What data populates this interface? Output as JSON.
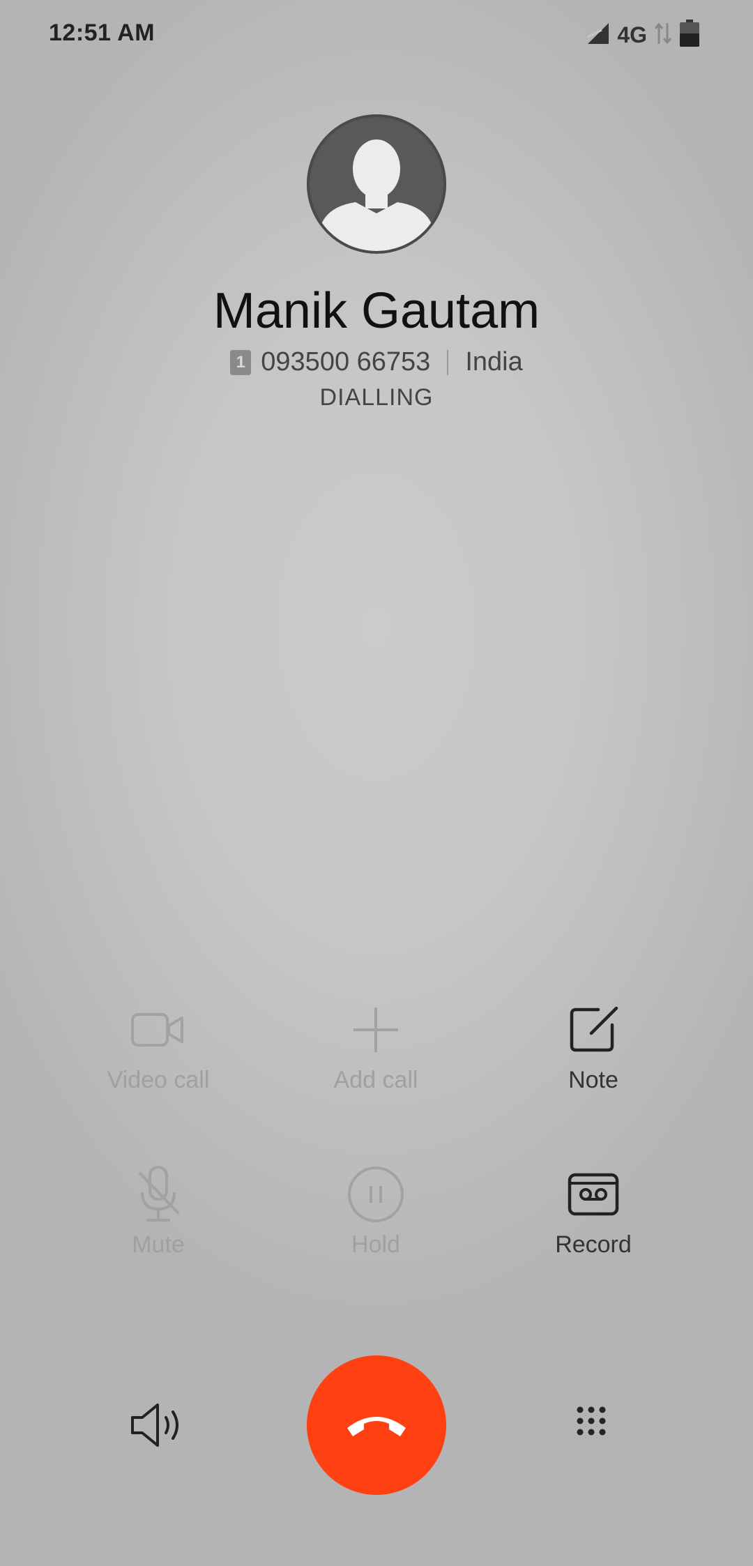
{
  "status_bar": {
    "time": "12:51 AM",
    "network": "4G",
    "icons": [
      "signal-icon",
      "data-arrows-icon",
      "battery-icon"
    ]
  },
  "contact": {
    "name": "Manik Gautam",
    "sim_slot": "1",
    "number": "093500 66753",
    "location": "India",
    "state": "DIALLING"
  },
  "actions": {
    "video_call": "Video call",
    "add_call": "Add call",
    "note": "Note",
    "mute": "Mute",
    "hold": "Hold",
    "record": "Record"
  },
  "colors": {
    "end_call": "#ff4012",
    "disabled_text": "#a0a0a0",
    "enabled_text": "#333333"
  },
  "bottom_icons": [
    "speaker-icon",
    "end-call-icon",
    "dialpad-icon"
  ]
}
